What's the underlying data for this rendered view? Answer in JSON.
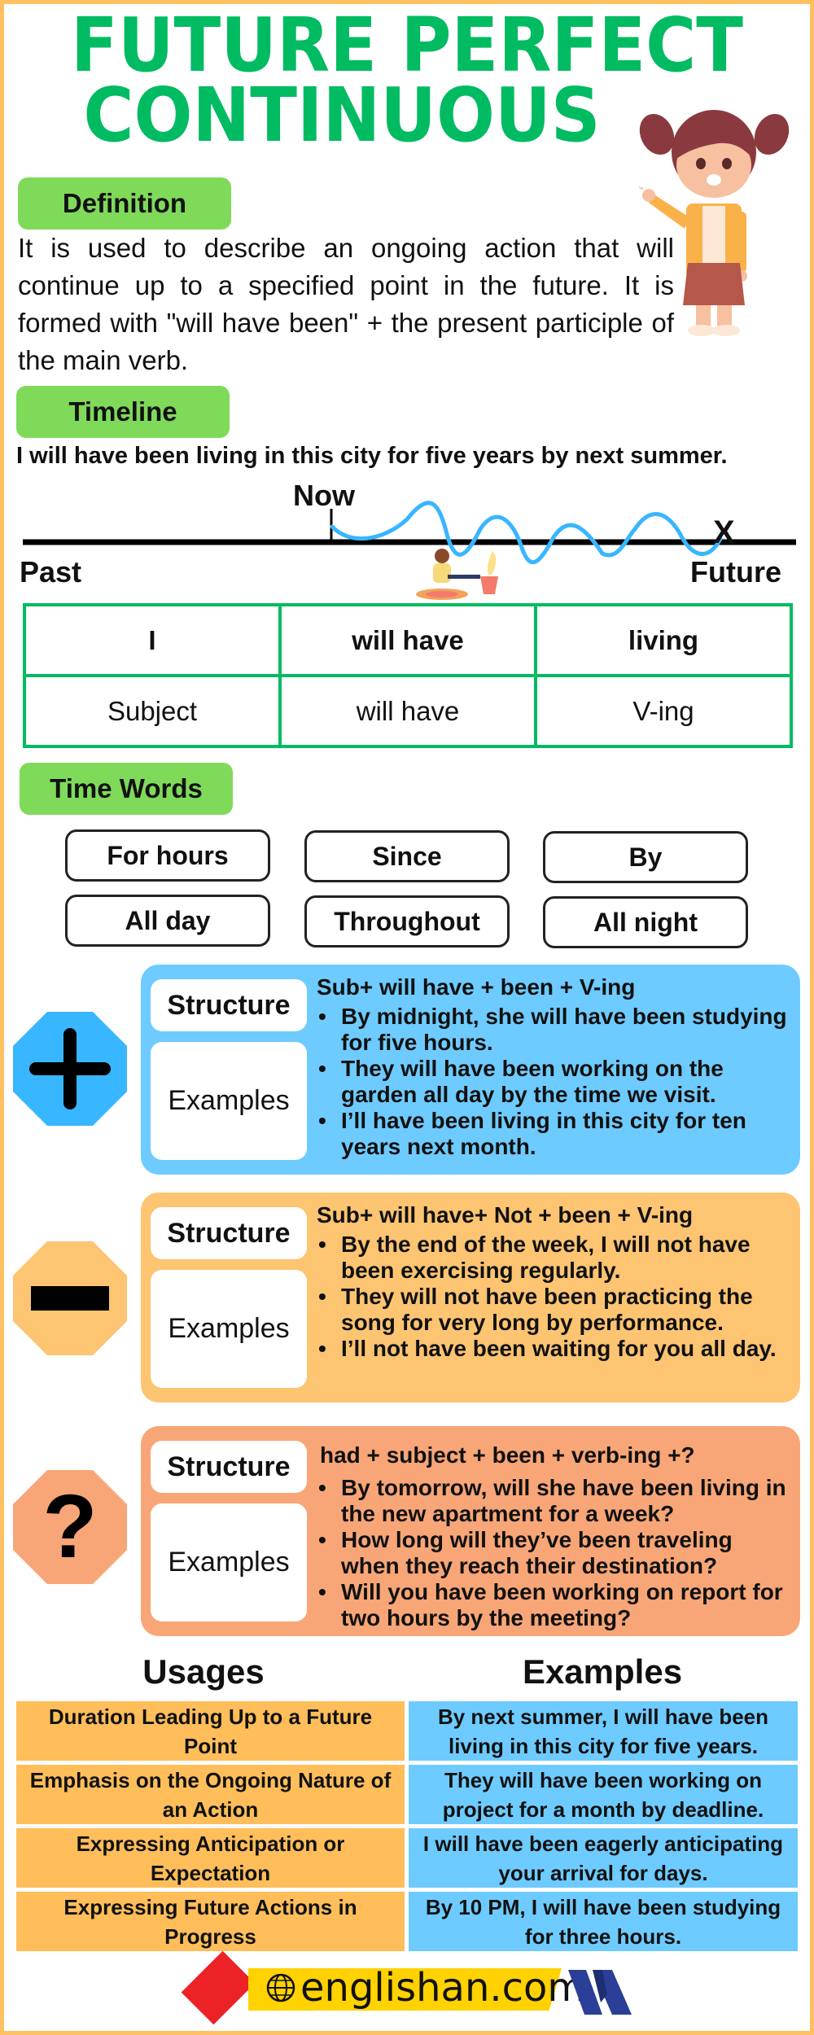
{
  "title": {
    "line1": "FUTURE PERFECT",
    "line2": "CONTINUOUS"
  },
  "colors": {
    "title_green": "#00bb61",
    "pill_green": "#7fda5a",
    "frame_orange": "#ffc061",
    "positive_blue": "#6ecbff",
    "negative_orange": "#fdc472",
    "question_salmon": "#f8a677",
    "wave_blue": "#38b6ff"
  },
  "definition": {
    "label": "Definition",
    "text": "It is used to describe an ongoing action that will continue up to a specified point in the future. It is formed with \"will have been\" + the present participle of the main verb."
  },
  "timeline": {
    "label": "Timeline",
    "sentence": "I will have been living in this city for five years by next summer.",
    "now_label": "Now",
    "past_label": "Past",
    "future_label": "Future",
    "end_marker": "X"
  },
  "structure_table": {
    "rows": [
      [
        "I",
        "will have",
        "living"
      ],
      [
        "Subject",
        "will have",
        "V-ing"
      ]
    ]
  },
  "time_words": {
    "label": "Time Words",
    "items": [
      "For hours",
      "Since",
      "By",
      "All day",
      "Throughout",
      "All night"
    ]
  },
  "forms": [
    {
      "type": "positive",
      "icon": "plus-icon",
      "structure_label": "Structure",
      "examples_label": "Examples",
      "structure": "Sub+ will have + been + V-ing",
      "examples": [
        "By midnight, she will have been studying for five hours.",
        "They will have been working on the garden all day by the time we visit.",
        "I’ll have been living in this city for ten years next month."
      ]
    },
    {
      "type": "negative",
      "icon": "minus-icon",
      "structure_label": "Structure",
      "examples_label": "Examples",
      "structure": "Sub+ will have+ Not + been + V-ing",
      "examples": [
        "By the end of the week, I will not have been exercising regularly.",
        "They will not have been practicing the song for very long by performance.",
        "I’ll not have been waiting for you all day."
      ]
    },
    {
      "type": "question",
      "icon": "question-mark-icon",
      "structure_label": "Structure",
      "examples_label": "Examples",
      "structure": "had + subject + been + verb-ing +?",
      "examples": [
        "By tomorrow, will she have been living in the new apartment for a week?",
        "How long will they’ve been traveling when they reach their destination?",
        "Will you have been working on report for two hours by the meeting?"
      ]
    }
  ],
  "usages": {
    "usages_header": "Usages",
    "examples_header": "Examples",
    "rows": [
      {
        "usage": "Duration Leading Up to a Future Point",
        "example": "By next summer, I will have been living in this city for five years."
      },
      {
        "usage": "Emphasis on the Ongoing Nature of an Action",
        "example": "They will have been working on project for a month by deadline."
      },
      {
        "usage": "Expressing Anticipation or Expectation",
        "example": "I will have been eagerly anticipating your arrival for days."
      },
      {
        "usage": "Expressing Future Actions in Progress",
        "example": "By 10 PM, I will have been studying for three hours."
      }
    ]
  },
  "footer": {
    "brand": "englishan.com"
  }
}
